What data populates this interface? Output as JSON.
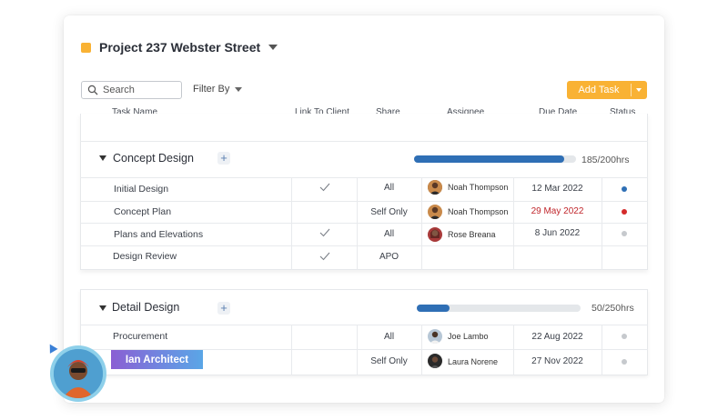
{
  "project": {
    "title": "Project 237 Webster Street",
    "accent": "#f9b234"
  },
  "toolbar": {
    "search_placeholder": "Search",
    "filter_label": "Filter By",
    "add_task_label": "Add Task"
  },
  "columns": {
    "task_name": "Task Name",
    "link_to_client": "Link To Client",
    "share": "Share",
    "assignee": "Assignee",
    "due_date": "Due Date",
    "status": "Status"
  },
  "groups": [
    {
      "name": "Concept Design",
      "hours_label": "185/200hrs",
      "progress": 0.925,
      "tasks": [
        {
          "name": "Initial Design",
          "linked": true,
          "share": "All",
          "assignee": "Noah Thompson",
          "due": "12 Mar 2022",
          "due_overdue": false,
          "status_color": "#2f6fb5"
        },
        {
          "name": "Concept Plan",
          "linked": false,
          "share": "Self Only",
          "assignee": "Noah Thompson",
          "due": "29 May 2022",
          "due_overdue": true,
          "status_color": "#d42a2a"
        },
        {
          "name": "Plans and Elevations",
          "linked": true,
          "share": "All",
          "assignee": "Rose Breana",
          "due": "8 Jun 2022",
          "due_overdue": false,
          "status_color": "#c6c9cd"
        },
        {
          "name": "Design Review",
          "linked": true,
          "share": "APO",
          "assignee": "",
          "due": "",
          "due_overdue": false,
          "status_color": ""
        }
      ]
    },
    {
      "name": "Detail Design",
      "hours_label": "50/250hrs",
      "progress": 0.2,
      "tasks": [
        {
          "name": "Procurement",
          "linked": false,
          "share": "All",
          "assignee": "Joe Lambo",
          "due": "22 Aug 2022",
          "due_overdue": false,
          "status_color": "#c6c9cd"
        },
        {
          "name": "",
          "linked": false,
          "share": "Self Only",
          "assignee": "Laura Norene",
          "due": "27 Nov 2022",
          "due_overdue": false,
          "status_color": "#c6c9cd"
        }
      ]
    }
  ],
  "cursor_user": {
    "name": "Ian Architect"
  },
  "colors": {
    "progress": "#2f6fb5",
    "overdue": "#c0262c",
    "add_button": "#f9b234"
  }
}
